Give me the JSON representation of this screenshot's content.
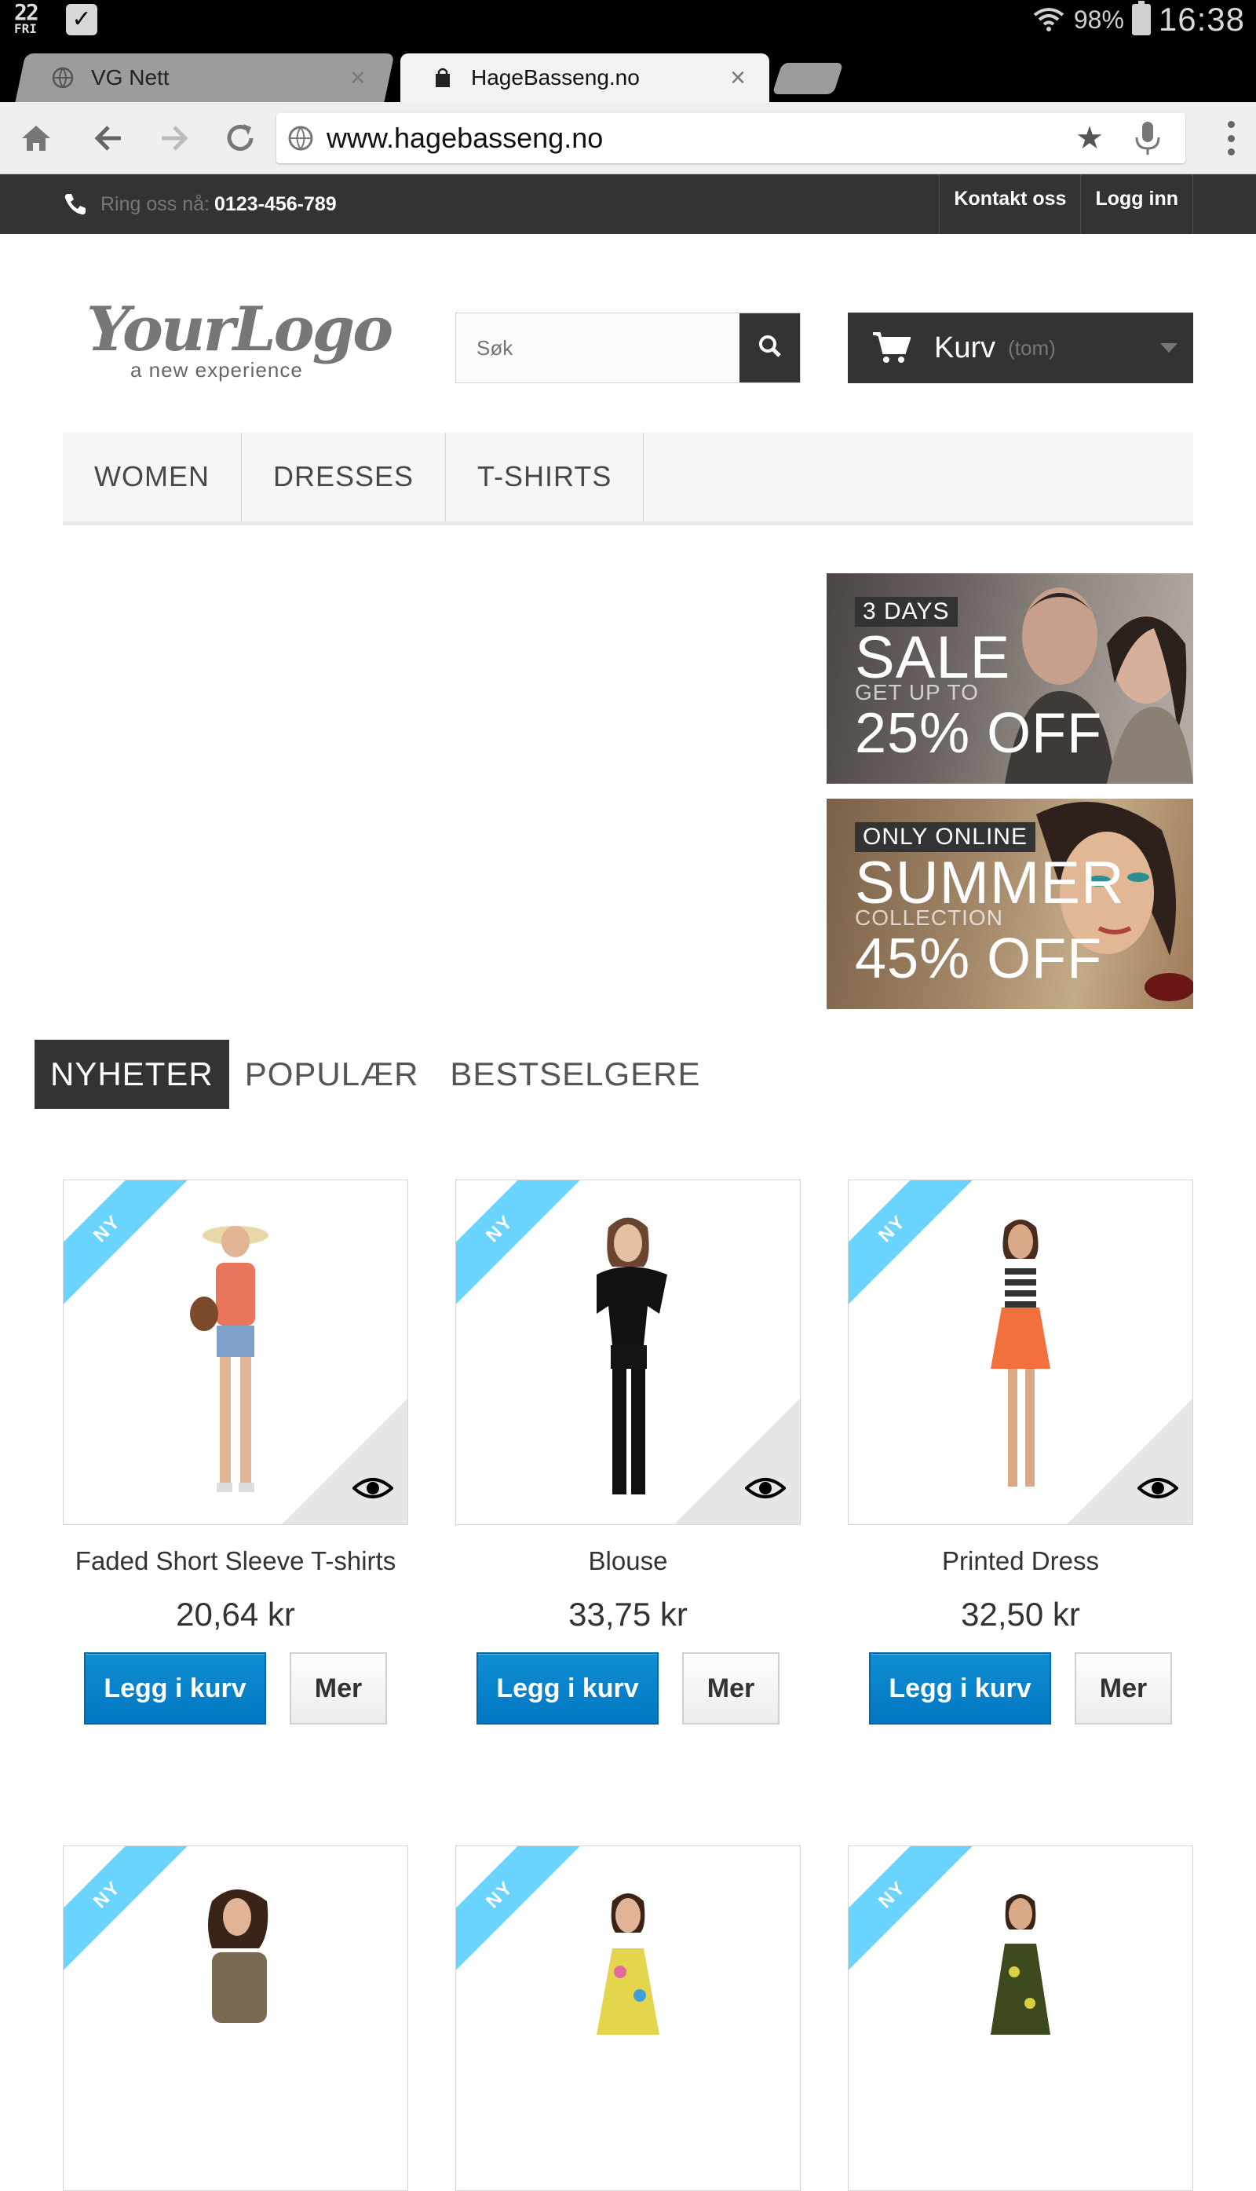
{
  "status_bar": {
    "day_num": "22",
    "day_name": "FRI",
    "battery": "98%",
    "time": "16:38"
  },
  "browser": {
    "tabs": [
      {
        "title": "VG Nett",
        "active": false
      },
      {
        "title": "HageBasseng.no",
        "active": true
      }
    ],
    "url": "www.hagebasseng.no"
  },
  "header": {
    "call_label": "Ring oss nå:",
    "phone": "0123-456-789",
    "links": [
      "Kontakt oss",
      "Logg inn"
    ]
  },
  "logo": {
    "text": "YourLogo",
    "tagline": "a new experience"
  },
  "search": {
    "placeholder": "Søk"
  },
  "cart": {
    "label": "Kurv",
    "status": "(tom)"
  },
  "menu": [
    "WOMEN",
    "DRESSES",
    "T-SHIRTS"
  ],
  "banners": [
    {
      "tag": "3 DAYS",
      "big": "SALE",
      "small": "GET UP TO",
      "off": "25% OFF"
    },
    {
      "tag": "ONLY ONLINE",
      "big": "SUMMER",
      "small": "COLLECTION",
      "off": "45% OFF"
    }
  ],
  "home_tabs": [
    "NYHETER",
    "POPULÆR",
    "BESTSELGERE"
  ],
  "ribbon_label": "NY",
  "products": [
    {
      "name": "Faded Short Sleeve T-shirts",
      "price": "20,64 kr",
      "add_label": "Legg i kurv",
      "more_label": "Mer"
    },
    {
      "name": "Blouse",
      "price": "33,75 kr",
      "add_label": "Legg i kurv",
      "more_label": "Mer"
    },
    {
      "name": "Printed Dress",
      "price": "32,50 kr",
      "add_label": "Legg i kurv",
      "more_label": "Mer"
    },
    {
      "name": "",
      "price": "",
      "add_label": "",
      "more_label": ""
    },
    {
      "name": "",
      "price": "",
      "add_label": "",
      "more_label": ""
    },
    {
      "name": "",
      "price": "",
      "add_label": "",
      "more_label": ""
    }
  ],
  "colors": {
    "accent_blue": "#0277c2",
    "ribbon": "#6ad4ff",
    "dark": "#333333"
  }
}
